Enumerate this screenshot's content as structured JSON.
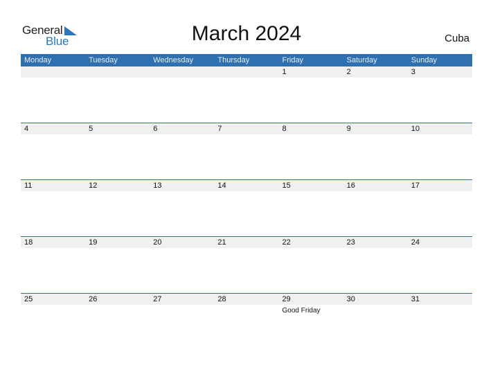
{
  "logo": {
    "word1": "General",
    "word2": "Blue"
  },
  "title": "March 2024",
  "country": "Cuba",
  "weekdays": [
    "Monday",
    "Tuesday",
    "Wednesday",
    "Thursday",
    "Friday",
    "Saturday",
    "Sunday"
  ],
  "weeks": [
    [
      "",
      "",
      "",
      "",
      "1",
      "2",
      "3"
    ],
    [
      "4",
      "5",
      "6",
      "7",
      "8",
      "9",
      "10"
    ],
    [
      "11",
      "12",
      "13",
      "14",
      "15",
      "16",
      "17"
    ],
    [
      "18",
      "19",
      "20",
      "21",
      "22",
      "23",
      "24"
    ],
    [
      "25",
      "26",
      "27",
      "28",
      "29",
      "30",
      "31"
    ]
  ],
  "holidays": [
    {
      "week": 4,
      "day": 4,
      "name": "Good Friday"
    }
  ],
  "colors": {
    "accent": "#2f70b1",
    "date_strip": "#f0f0f0",
    "logo_blue": "#2a77c0"
  }
}
